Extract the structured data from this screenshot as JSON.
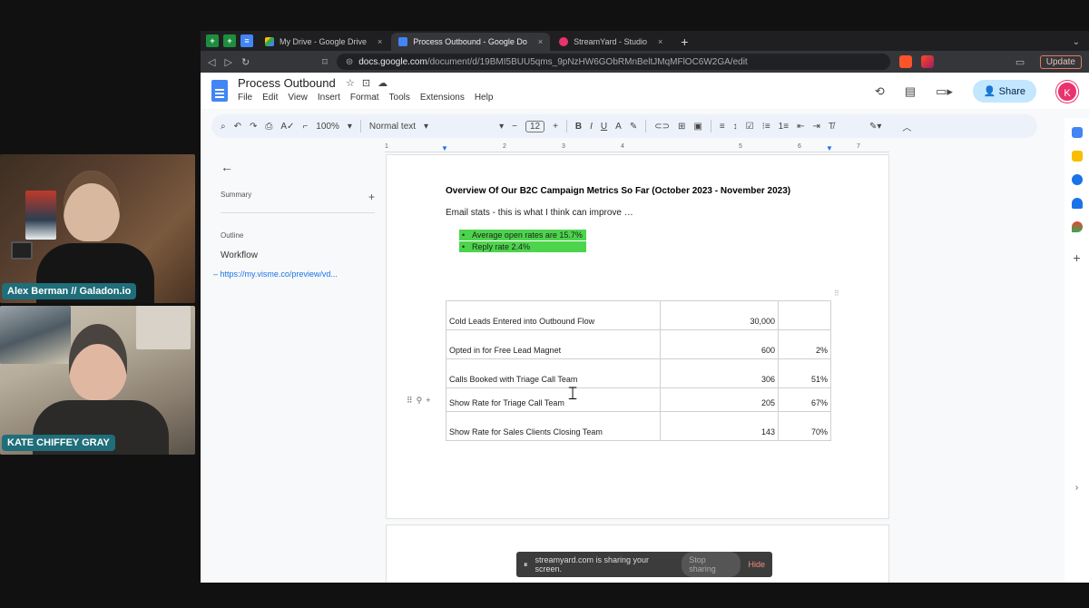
{
  "participants": [
    {
      "name": "Alex Berman // Galadon.io"
    },
    {
      "name": "KATE CHIFFEY GRAY"
    }
  ],
  "browser": {
    "tabs": [
      {
        "label": "My Drive - Google Drive",
        "active": false
      },
      {
        "label": "Process Outbound - Google Do",
        "active": true
      },
      {
        "label": "StreamYard - Studio",
        "active": false
      }
    ],
    "url": {
      "domain": "docs.google.com",
      "path": "/document/d/19BMI5BUU5qms_9pNzHW6GObRMnBeltJMqMFlOC6W2GA/edit"
    },
    "update_label": "Update"
  },
  "docs": {
    "title": "Process Outbound",
    "menus": [
      "File",
      "Edit",
      "View",
      "Insert",
      "Format",
      "Tools",
      "Extensions",
      "Help"
    ],
    "share_label": "Share",
    "avatar_initial": "K",
    "toolbar": {
      "zoom": "100%",
      "style": "Normal text",
      "font_size": "12"
    }
  },
  "outline": {
    "summary_label": "Summary",
    "outline_label": "Outline",
    "items": [
      "Workflow",
      "https://my.visme.co/preview/vd..."
    ]
  },
  "document": {
    "heading": "Overview Of Our B2C Campaign Metrics So Far  (October 2023 - November 2023)",
    "intro": "Email stats - this is what I think can improve …",
    "bullets": [
      "Average open rates are 15.7%",
      "Reply rate 2.4%"
    ],
    "table": [
      {
        "label": "Cold Leads Entered into Outbound Flow",
        "count": "30,000",
        "pct": ""
      },
      {
        "label": "Opted in for Free Lead Magnet",
        "count": "600",
        "pct": "2%"
      },
      {
        "label": "Calls Booked with Triage Call Team",
        "count": "306",
        "pct": "51%"
      },
      {
        "label": "Show Rate for Triage Call Team",
        "count": "205",
        "pct": "67%"
      },
      {
        "label": "Show Rate for Sales Clients Closing Team",
        "count": "143",
        "pct": "70%"
      }
    ]
  },
  "ruler_marks": [
    "1",
    "2",
    "3",
    "4",
    "5",
    "6",
    "7"
  ],
  "share_notice": {
    "text": "streamyard.com is sharing your screen.",
    "stop_label": "Stop sharing",
    "hide_label": "Hide"
  }
}
